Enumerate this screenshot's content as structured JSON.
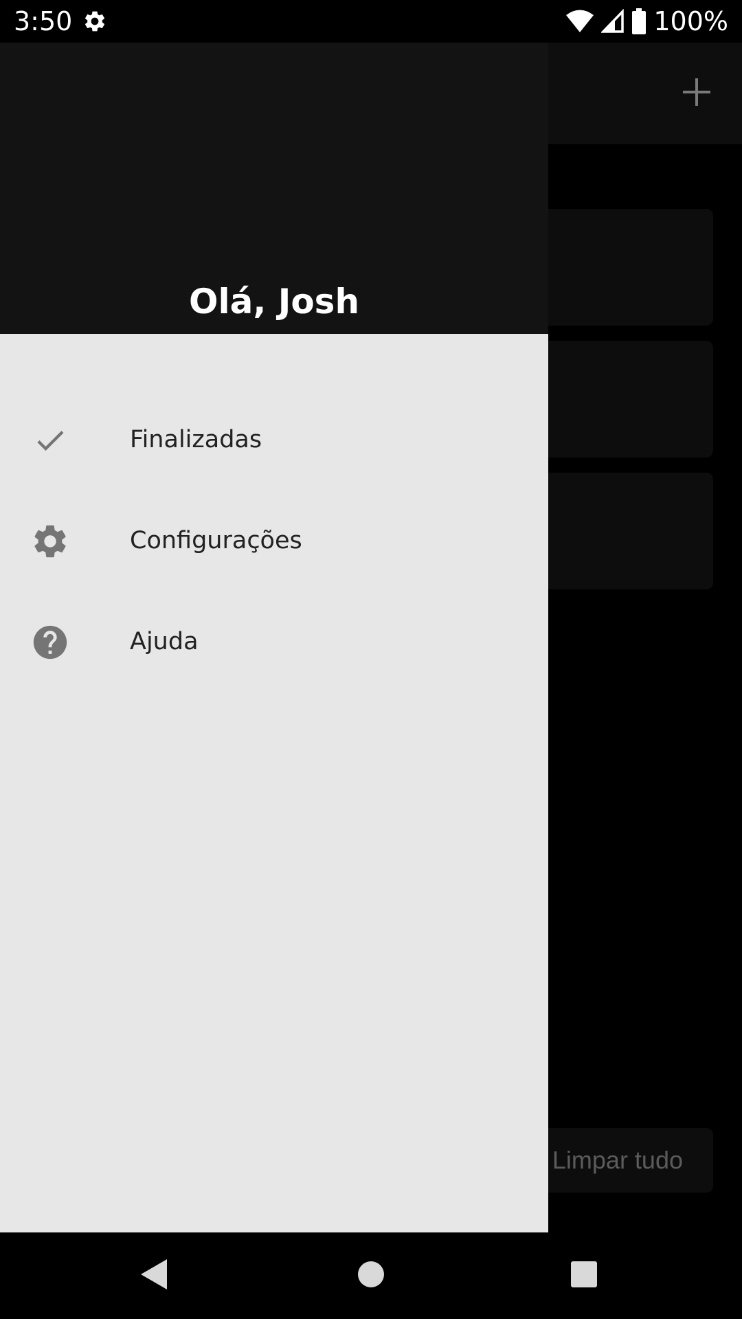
{
  "status_bar": {
    "time": "3:50",
    "battery_percent": "100%",
    "icons": [
      "settings-icon",
      "wifi-icon",
      "cell-signal-icon",
      "battery-icon"
    ]
  },
  "drawer": {
    "greeting": "Olá, Josh",
    "items": [
      {
        "label": "Finalizadas",
        "icon": "check-icon"
      },
      {
        "label": "Configurações",
        "icon": "gear-icon"
      },
      {
        "label": "Ajuda",
        "icon": "help-icon"
      }
    ]
  },
  "background_app": {
    "toolbar": {
      "add_icon": "plus-icon"
    },
    "clear_all_label": "Limpar tudo"
  },
  "nav_bar": {
    "buttons": [
      "back-icon",
      "home-icon",
      "recents-icon"
    ]
  },
  "colors": {
    "drawer_background": "#e7e7e7",
    "drawer_header": "#131313",
    "icon_gray": "#757575",
    "app_background": "#000000"
  }
}
